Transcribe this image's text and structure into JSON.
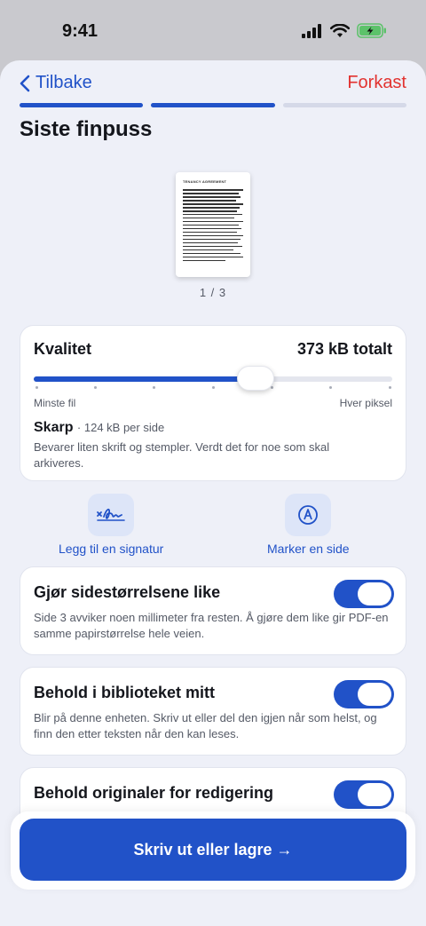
{
  "status_bar": {
    "time": "9:41"
  },
  "nav": {
    "back_label": "Tilbake",
    "discard_label": "Forkast"
  },
  "progress": {
    "total_steps": 3,
    "completed_steps": 2
  },
  "page_title": "Siste finpuss",
  "preview": {
    "doc_title": "TENANCY AGREEMENT",
    "page_counter": "1 / 3"
  },
  "quality": {
    "title": "Kvalitet",
    "total": "373 kB totalt",
    "slider_value_fraction": 0.62,
    "tick_count": 7,
    "min_label": "Minste fil",
    "max_label": "Hver piksel",
    "level_name": "Skarp",
    "per_page": "· 124 kB per side",
    "description": "Bevarer liten skrift og stempler. Verdt det for noe som skal arkiveres."
  },
  "actions": {
    "signature": {
      "label": "Legg til en signatur",
      "icon": "signature-icon"
    },
    "mark": {
      "label": "Marker en side",
      "icon": "markup-pen-icon"
    }
  },
  "toggles": [
    {
      "title": "Gjør sidestørrelsene like",
      "description": "Side 3 avviker noen millimeter fra resten. Å gjøre dem like gir PDF-en samme papirstørrelse hele veien.",
      "on": true
    },
    {
      "title": "Behold i biblioteket mitt",
      "description": "Blir på denne enheten. Skriv ut eller del den igjen når som helst, og finn den etter teksten når den kan leses.",
      "on": true
    },
    {
      "title": "Behold originaler for redigering",
      "description": "",
      "on": true
    }
  ],
  "primary_button": {
    "label": "Skriv ut eller lagre →"
  },
  "colors": {
    "accent": "#2152c8",
    "destructive": "#e2322f",
    "background": "#eef0f8"
  }
}
